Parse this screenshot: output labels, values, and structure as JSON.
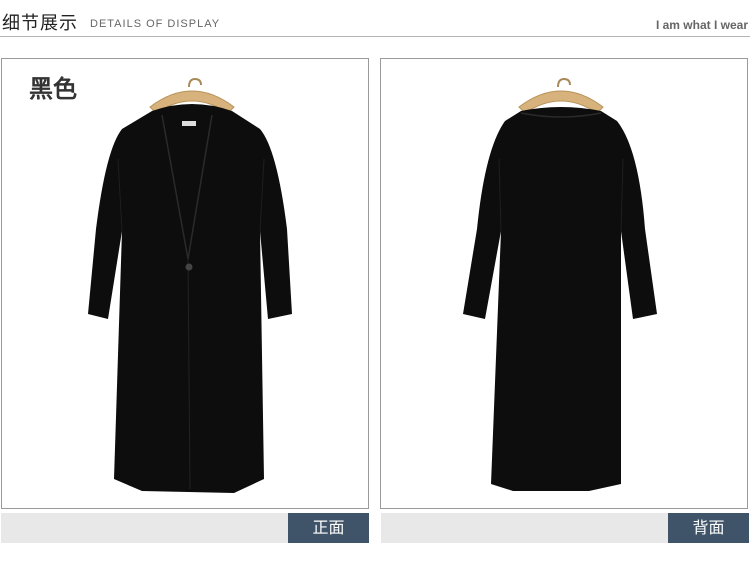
{
  "header": {
    "title": "细节展示",
    "subtitle": "DETAILS OF DISPLAY",
    "tagline": "I am what I wear"
  },
  "panels": [
    {
      "color_label": "黑色",
      "caption": "正面",
      "view": "front"
    },
    {
      "caption": "背面",
      "view": "back"
    }
  ],
  "colors": {
    "caption_button_bg": "#3f5468",
    "caption_bar_bg": "#e8e8e8",
    "garment": "#0d0d0d",
    "hanger": "#d8b27c"
  }
}
